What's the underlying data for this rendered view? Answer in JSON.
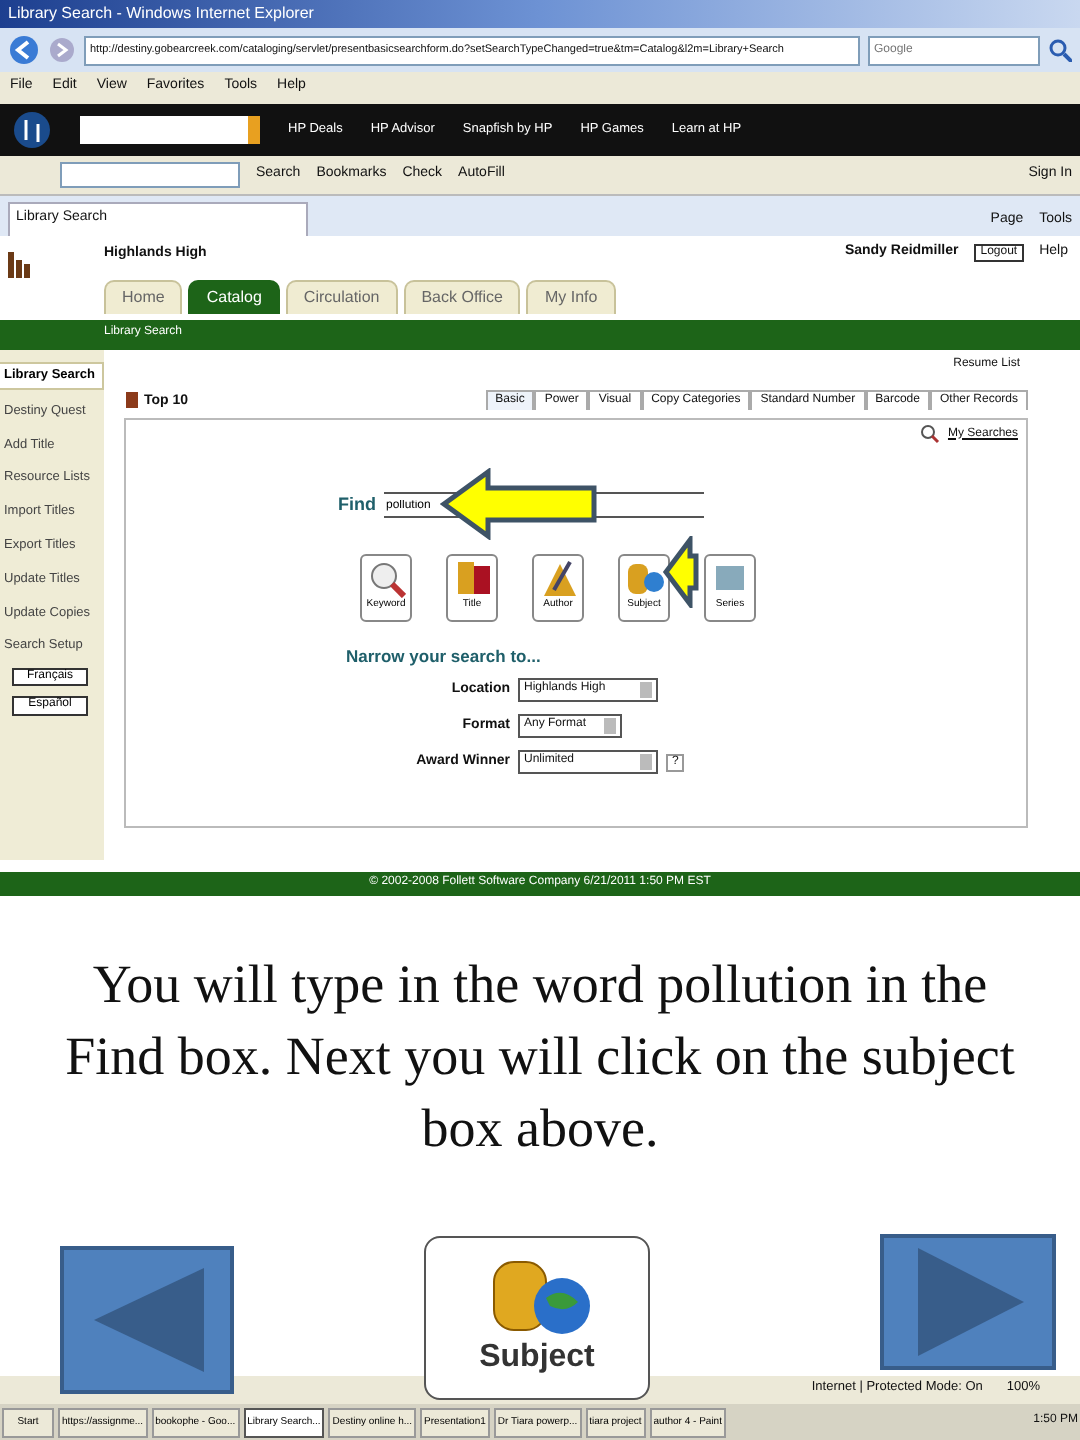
{
  "window": {
    "title": "Library Search - Windows Internet Explorer"
  },
  "address_bar": {
    "url": "http://destiny.gobearcreek.com/cataloging/servlet/presentbasicsearchform.do?setSearchTypeChanged=true&tm=Catalog&l2m=Library+Search"
  },
  "search_box": {
    "placeholder": "Google"
  },
  "menu": [
    "File",
    "Edit",
    "View",
    "Favorites",
    "Tools",
    "Help"
  ],
  "hp_toolbar": {
    "items": [
      "HP Deals",
      "HP Advisor",
      "Snapfish by HP",
      "HP Games",
      "Learn at HP"
    ]
  },
  "google_toolbar": {
    "items": [
      "Search",
      "Bookmarks",
      "Check",
      "AutoFill"
    ],
    "sign_in": "Sign In"
  },
  "browser_tab": {
    "title": "Library Search"
  },
  "command_bar": [
    "Page",
    "Tools"
  ],
  "site": {
    "school": "Highlands High",
    "user": "Sandy Reidmiller",
    "logout": "Logout",
    "help": "Help",
    "tabs": [
      {
        "label": "Home",
        "selected": false
      },
      {
        "label": "Catalog",
        "selected": true
      },
      {
        "label": "Circulation",
        "selected": false
      },
      {
        "label": "Back Office",
        "selected": false
      },
      {
        "label": "My Info",
        "selected": false
      }
    ],
    "subnav": "Library Search",
    "sidebar": [
      {
        "label": "Library Search",
        "selected": true,
        "kind": "link"
      },
      {
        "label": "Destiny Quest",
        "selected": false,
        "kind": "link"
      },
      {
        "label": "Add Title",
        "selected": false,
        "kind": "link"
      },
      {
        "label": "Resource Lists",
        "selected": false,
        "kind": "link"
      },
      {
        "label": "Import Titles",
        "selected": false,
        "kind": "link"
      },
      {
        "label": "Export Titles",
        "selected": false,
        "kind": "link"
      },
      {
        "label": "Update Titles",
        "selected": false,
        "kind": "link"
      },
      {
        "label": "Update Copies",
        "selected": false,
        "kind": "link"
      },
      {
        "label": "Search Setup",
        "selected": false,
        "kind": "link"
      },
      {
        "label": "Français",
        "selected": false,
        "kind": "language"
      },
      {
        "label": "Español",
        "selected": false,
        "kind": "language"
      }
    ],
    "resume": "Resume List",
    "top10": "Top 10",
    "search_tabs": [
      {
        "label": "Basic",
        "selected": true
      },
      {
        "label": "Power",
        "selected": false
      },
      {
        "label": "Visual",
        "selected": false
      },
      {
        "label": "Copy Categories",
        "selected": false
      },
      {
        "label": "Standard Number",
        "selected": false
      },
      {
        "label": "Barcode",
        "selected": false
      },
      {
        "label": "Other Records",
        "selected": false
      }
    ],
    "my_searches": "My Searches",
    "find": {
      "label": "Find",
      "value": "pollution"
    },
    "search_buttons": [
      "Keyword",
      "Title",
      "Author",
      "Subject",
      "Series"
    ],
    "narrow": "Narrow your search to...",
    "filters": [
      {
        "label": "Location",
        "value": "Highlands High"
      },
      {
        "label": "Format",
        "value": "Any Format"
      },
      {
        "label": "Award Winner",
        "value": "Unlimited",
        "help": "?"
      }
    ],
    "footer": "© 2002-2008 Follett Software Company    6/21/2011 1:50 PM EST"
  },
  "slide": {
    "caption": "You will type in the word pollution in the Find box.  Next you will click on the subject box above.",
    "subject_button": "Subject"
  },
  "status_bar": {
    "zone": "Internet | Protected Mode: On",
    "zoom": "100%"
  },
  "taskbar": {
    "start": "Start",
    "items": [
      {
        "label": "https://assignme...",
        "selected": false
      },
      {
        "label": "bookophe - Goo...",
        "selected": false
      },
      {
        "label": "Library Search...",
        "selected": true
      },
      {
        "label": "Destiny online h...",
        "selected": false
      },
      {
        "label": "Presentation1",
        "selected": false
      },
      {
        "label": "Dr Tiara powerp...",
        "selected": false
      },
      {
        "label": "tiara project",
        "selected": false
      },
      {
        "label": "author 4 - Paint",
        "selected": false
      }
    ],
    "clock": "1:50 PM"
  }
}
